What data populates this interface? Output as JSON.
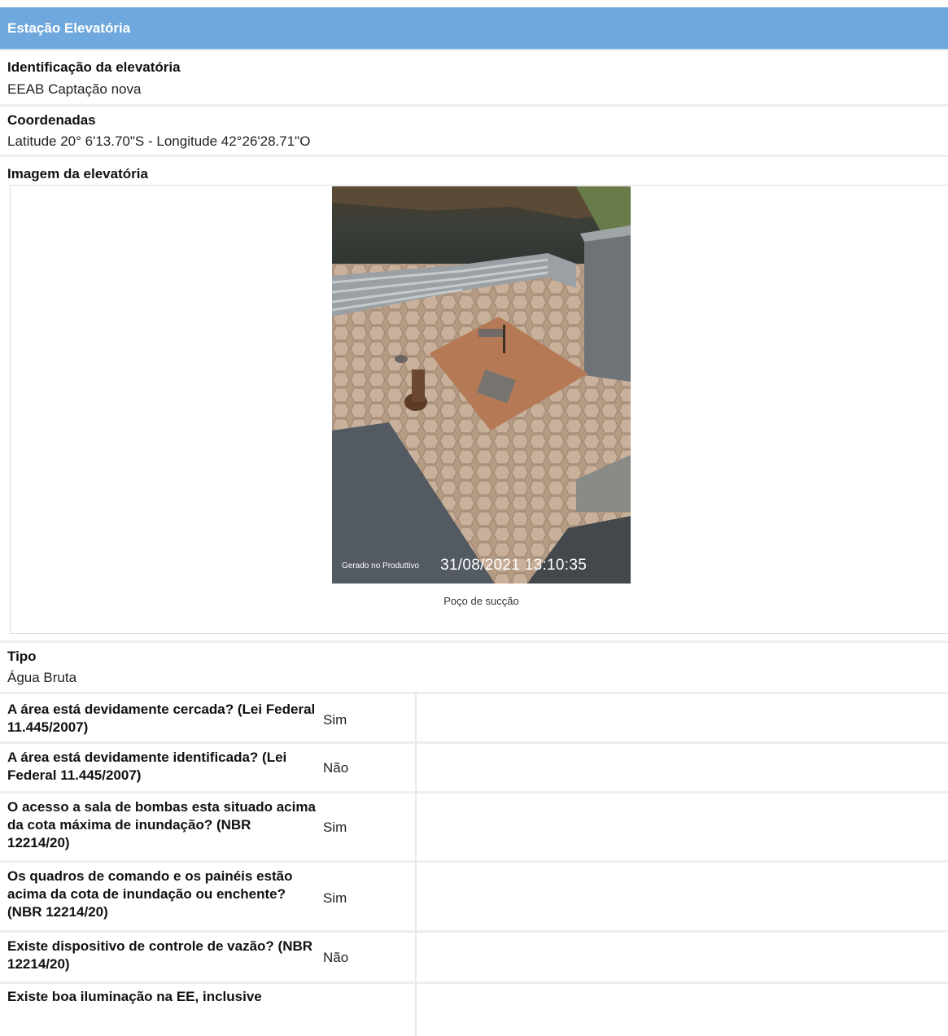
{
  "header": {
    "title": "Estação Elevatória"
  },
  "identificacao": {
    "label": "Identificação da elevatória",
    "value": "EEAB Captação nova"
  },
  "coordenadas": {
    "label": "Coordenadas",
    "value": "Latitude 20° 6'13.70\"S - Longitude 42°26'28.71\"O"
  },
  "imagem": {
    "label": "Imagem da elevatória",
    "watermark_brand": "Gerado no Produttivo",
    "timestamp": "31/08/2021 13:10:35",
    "caption": "Poço de sucção"
  },
  "tipo": {
    "label": "Tipo",
    "value": "Água Bruta"
  },
  "questions": [
    {
      "q": "A área está devidamente cercada? (Lei Federal 11.445/2007)",
      "a": "Sim"
    },
    {
      "q": "A área está devidamente identificada? (Lei Federal 11.445/2007)",
      "a": "Não"
    },
    {
      "q": "O acesso a sala de bombas esta situado acima da cota máxima de inundação? (NBR 12214/20)",
      "a": "Sim"
    },
    {
      "q": "Os quadros de comando e os painéis estão acima da cota de inundação ou enchente? (NBR 12214/20)",
      "a": "Sim"
    },
    {
      "q": "Existe dispositivo de controle de vazão? (NBR 12214/20)",
      "a": "Não"
    },
    {
      "q": "Existe boa iluminação na EE, inclusive",
      "a": ""
    }
  ]
}
